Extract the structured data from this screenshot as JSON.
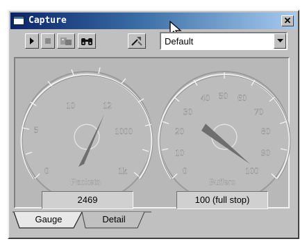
{
  "window": {
    "title": "Capture",
    "close_glyph": "✕"
  },
  "toolbar": {
    "buttons": [
      "play-icon",
      "stop-icon",
      "capture-filter-icon",
      "find-icon",
      "settings-icon"
    ],
    "profile_select": {
      "value": "Default"
    }
  },
  "gauges": {
    "packets": {
      "name": "Packets",
      "tick_labels": [
        "0",
        "5",
        "10",
        "12",
        "1000",
        "1k"
      ],
      "readout": "2469"
    },
    "buffers": {
      "name": "Buffers",
      "tick_labels": [
        "0",
        "10",
        "20",
        "30",
        "40",
        "50",
        "60",
        "70",
        "80",
        "90",
        "100"
      ],
      "max": 100,
      "value": 100,
      "readout": "100 (full stop)"
    }
  },
  "tabs": [
    {
      "label": "Gauge",
      "active": true
    },
    {
      "label": "Detail",
      "active": false
    }
  ],
  "colors": {
    "titlebar_start": "#0a246a",
    "needle": "#6e6e6e",
    "face": "#b8b8b8"
  }
}
